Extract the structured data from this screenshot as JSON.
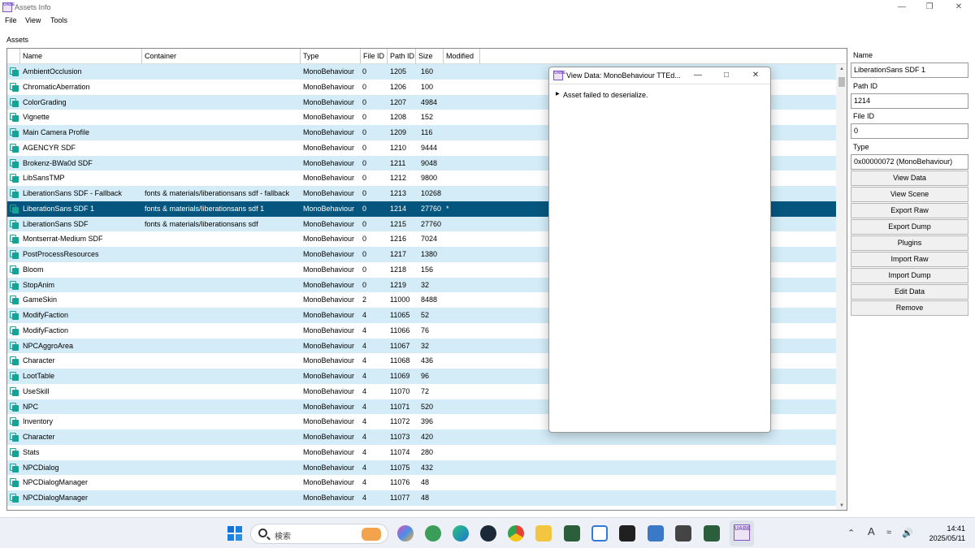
{
  "window": {
    "title": "Assets Info",
    "app_icon": "UABE"
  },
  "menu": {
    "file": "File",
    "view": "View",
    "tools": "Tools"
  },
  "assets_label": "Assets",
  "columns": {
    "name": "Name",
    "container": "Container",
    "type": "Type",
    "file_id": "File ID",
    "path_id": "Path ID",
    "size": "Size",
    "modified": "Modified"
  },
  "rows": [
    {
      "name": "AmbientOcclusion",
      "container": "",
      "type": "MonoBehaviour",
      "file_id": "0",
      "path_id": "1205",
      "size": "160",
      "modified": ""
    },
    {
      "name": "ChromaticAberration",
      "container": "",
      "type": "MonoBehaviour",
      "file_id": "0",
      "path_id": "1206",
      "size": "100",
      "modified": ""
    },
    {
      "name": "ColorGrading",
      "container": "",
      "type": "MonoBehaviour",
      "file_id": "0",
      "path_id": "1207",
      "size": "4984",
      "modified": ""
    },
    {
      "name": "Vignette",
      "container": "",
      "type": "MonoBehaviour",
      "file_id": "0",
      "path_id": "1208",
      "size": "152",
      "modified": ""
    },
    {
      "name": "Main Camera Profile",
      "container": "",
      "type": "MonoBehaviour",
      "file_id": "0",
      "path_id": "1209",
      "size": "116",
      "modified": ""
    },
    {
      "name": "AGENCYR SDF",
      "container": "",
      "type": "MonoBehaviour",
      "file_id": "0",
      "path_id": "1210",
      "size": "9444",
      "modified": ""
    },
    {
      "name": "Brokenz-BWa0d SDF",
      "container": "",
      "type": "MonoBehaviour",
      "file_id": "0",
      "path_id": "1211",
      "size": "9048",
      "modified": ""
    },
    {
      "name": "LibSansTMP",
      "container": "",
      "type": "MonoBehaviour",
      "file_id": "0",
      "path_id": "1212",
      "size": "9800",
      "modified": ""
    },
    {
      "name": "LiberationSans SDF - Fallback",
      "container": "fonts & materials/liberationsans sdf - fallback",
      "type": "MonoBehaviour",
      "file_id": "0",
      "path_id": "1213",
      "size": "10268",
      "modified": ""
    },
    {
      "name": "LiberationSans SDF 1",
      "container": "fonts & materials/liberationsans sdf 1",
      "type": "MonoBehaviour",
      "file_id": "0",
      "path_id": "1214",
      "size": "27760",
      "modified": "*"
    },
    {
      "name": "LiberationSans SDF",
      "container": "fonts & materials/liberationsans sdf",
      "type": "MonoBehaviour",
      "file_id": "0",
      "path_id": "1215",
      "size": "27760",
      "modified": ""
    },
    {
      "name": "Montserrat-Medium SDF",
      "container": "",
      "type": "MonoBehaviour",
      "file_id": "0",
      "path_id": "1216",
      "size": "7024",
      "modified": ""
    },
    {
      "name": "PostProcessResources",
      "container": "",
      "type": "MonoBehaviour",
      "file_id": "0",
      "path_id": "1217",
      "size": "1380",
      "modified": ""
    },
    {
      "name": "Bloom",
      "container": "",
      "type": "MonoBehaviour",
      "file_id": "0",
      "path_id": "1218",
      "size": "156",
      "modified": ""
    },
    {
      "name": "StopAnim",
      "container": "",
      "type": "MonoBehaviour",
      "file_id": "0",
      "path_id": "1219",
      "size": "32",
      "modified": ""
    },
    {
      "name": "GameSkin",
      "container": "",
      "type": "MonoBehaviour",
      "file_id": "2",
      "path_id": "11000",
      "size": "8488",
      "modified": ""
    },
    {
      "name": "ModifyFaction",
      "container": "",
      "type": "MonoBehaviour",
      "file_id": "4",
      "path_id": "11065",
      "size": "52",
      "modified": ""
    },
    {
      "name": "ModifyFaction",
      "container": "",
      "type": "MonoBehaviour",
      "file_id": "4",
      "path_id": "11066",
      "size": "76",
      "modified": ""
    },
    {
      "name": "NPCAggroArea",
      "container": "",
      "type": "MonoBehaviour",
      "file_id": "4",
      "path_id": "11067",
      "size": "32",
      "modified": ""
    },
    {
      "name": "Character",
      "container": "",
      "type": "MonoBehaviour",
      "file_id": "4",
      "path_id": "11068",
      "size": "436",
      "modified": ""
    },
    {
      "name": "LootTable",
      "container": "",
      "type": "MonoBehaviour",
      "file_id": "4",
      "path_id": "11069",
      "size": "96",
      "modified": ""
    },
    {
      "name": "UseSkill",
      "container": "",
      "type": "MonoBehaviour",
      "file_id": "4",
      "path_id": "11070",
      "size": "72",
      "modified": ""
    },
    {
      "name": "NPC",
      "container": "",
      "type": "MonoBehaviour",
      "file_id": "4",
      "path_id": "11071",
      "size": "520",
      "modified": ""
    },
    {
      "name": "Inventory",
      "container": "",
      "type": "MonoBehaviour",
      "file_id": "4",
      "path_id": "11072",
      "size": "396",
      "modified": ""
    },
    {
      "name": "Character",
      "container": "",
      "type": "MonoBehaviour",
      "file_id": "4",
      "path_id": "11073",
      "size": "420",
      "modified": ""
    },
    {
      "name": "Stats",
      "container": "",
      "type": "MonoBehaviour",
      "file_id": "4",
      "path_id": "11074",
      "size": "280",
      "modified": ""
    },
    {
      "name": "NPCDialog",
      "container": "",
      "type": "MonoBehaviour",
      "file_id": "4",
      "path_id": "11075",
      "size": "432",
      "modified": ""
    },
    {
      "name": "NPCDialogManager",
      "container": "",
      "type": "MonoBehaviour",
      "file_id": "4",
      "path_id": "11076",
      "size": "48",
      "modified": ""
    },
    {
      "name": "NPCDialogManager",
      "container": "",
      "type": "MonoBehaviour",
      "file_id": "4",
      "path_id": "11077",
      "size": "48",
      "modified": ""
    }
  ],
  "selected_row_index": 9,
  "side": {
    "name_label": "Name",
    "name_value": "LiberationSans SDF 1",
    "path_id_label": "Path ID",
    "path_id_value": "1214",
    "file_id_label": "File ID",
    "file_id_value": "0",
    "type_label": "Type",
    "type_value": "0x00000072 (MonoBehaviour)",
    "buttons": [
      "View Data",
      "View Scene",
      "Export Raw",
      "Export Dump",
      "Plugins",
      "Import Raw",
      "Import Dump",
      "Edit Data",
      "Remove"
    ]
  },
  "dialog": {
    "title": "View Data: MonoBehaviour TTEd...",
    "message": "Asset failed to deserialize."
  },
  "taskbar": {
    "search_placeholder": "検索",
    "time": "14:41",
    "date": "2025/05/11",
    "ime": "A"
  },
  "colors": {
    "row_alt": "#d4ecf7",
    "row_selected": "#05567f",
    "asset_icon": "#14a394",
    "uabe_purple": "#7e57c2"
  }
}
